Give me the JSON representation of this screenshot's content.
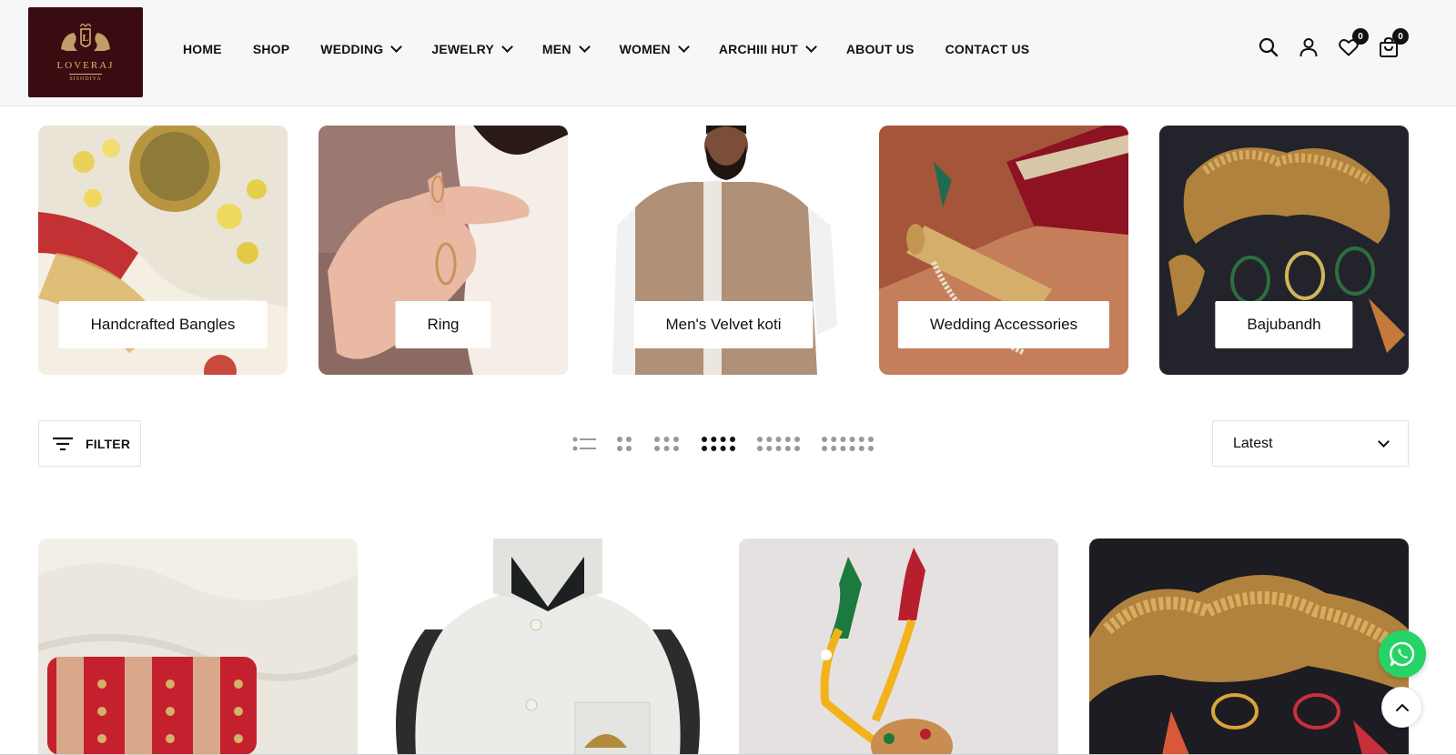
{
  "brand": {
    "name": "LOVERAJ",
    "sub": "SISODIYA",
    "monogram": "L",
    "bg_color": "#3a0b10",
    "gold_color": "#d9b77a"
  },
  "nav": {
    "items": [
      {
        "label": "HOME",
        "dropdown": false
      },
      {
        "label": "SHOP",
        "dropdown": false
      },
      {
        "label": "WEDDING",
        "dropdown": true
      },
      {
        "label": "JEWELRY",
        "dropdown": true
      },
      {
        "label": "MEN",
        "dropdown": true
      },
      {
        "label": "WOMEN",
        "dropdown": true
      },
      {
        "label": "ARCHIII HUT",
        "dropdown": true
      },
      {
        "label": "ABOUT US",
        "dropdown": false
      },
      {
        "label": "CONTACT US",
        "dropdown": false
      }
    ]
  },
  "header_icons": {
    "search": "search-icon",
    "account": "user-icon",
    "wishlist": {
      "icon": "heart-icon",
      "count": "0"
    },
    "cart": {
      "icon": "shopping-bag-icon",
      "count": "0"
    }
  },
  "collections": [
    {
      "label": "Handcrafted Bangles"
    },
    {
      "label": "Ring"
    },
    {
      "label": "Men's Velvet koti"
    },
    {
      "label": "Wedding Accessories"
    },
    {
      "label": "Bajubandh"
    }
  ],
  "toolbar": {
    "filter_label": "FILTER",
    "grid_options": [
      "list",
      "2-columns",
      "3-columns",
      "4-columns",
      "5-columns",
      "6-columns"
    ],
    "active_grid": "4-columns",
    "sort_value": "Latest"
  },
  "floating": {
    "whatsapp": "whatsapp-icon",
    "back_to_top": "chevron-up-icon",
    "whatsapp_color": "#25d366"
  }
}
